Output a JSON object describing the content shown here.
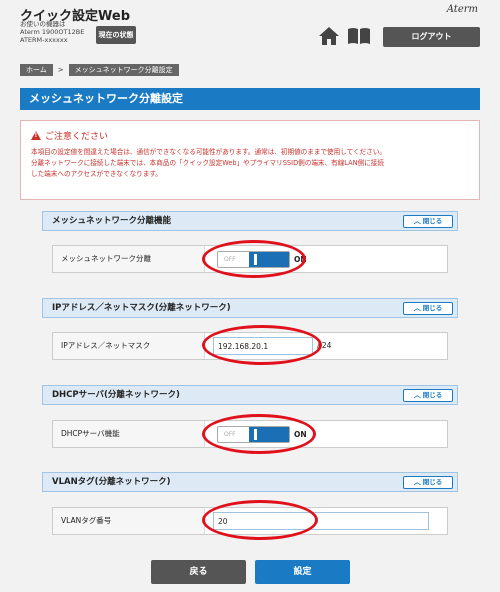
{
  "header": {
    "app_title": "クイック設定Web",
    "device_lines": [
      "お使いの機器は",
      "Aterm 1900OT12BE",
      "ATERM-xxxxxx"
    ],
    "status_button": "現在の状態",
    "brand": "Aterm",
    "logout_button": "ログアウト"
  },
  "breadcrumb": {
    "home": "ホーム",
    "separator": ">",
    "current": "メッシュネットワーク分離設定"
  },
  "page_title": "メッシュネットワーク分離設定",
  "notice": {
    "heading": "ご注意ください",
    "lines": [
      "本項目の設定値を間違えた場合は、通信ができなくなる可能性があります。通常は、初期値のままで使用してください。",
      "分離ネットワークに接続した端末では、本商品の「クイック設定Web」やプライマリSSID側の端末、有線LAN側に接続",
      "した端末へのアクセスができなくなります。"
    ]
  },
  "close_label": "閉じる",
  "sections": {
    "mesh": {
      "title": "メッシュネットワーク分離機能",
      "label": "メッシュネットワーク分離",
      "toggle_off": "OFF",
      "toggle_on": "ON"
    },
    "ip": {
      "title": "IPアドレス／ネットマスク(分離ネットワーク)",
      "label": "IPアドレス／ネットマスク",
      "ip_value": "192.168.20.1",
      "mask_value": "/ 24"
    },
    "dhcp": {
      "title": "DHCPサーバ(分離ネットワーク)",
      "label": "DHCPサーバ機能",
      "toggle_off": "OFF",
      "toggle_on": "ON"
    },
    "vlan": {
      "title": "VLANタグ(分離ネットワーク)",
      "label": "VLANタグ番号",
      "vlan_value": "20"
    }
  },
  "buttons": {
    "back": "戻る",
    "set": "設定"
  },
  "colors": {
    "accent": "#1a7bc4",
    "warning": "#c9302c",
    "highlight": "#e0111b"
  }
}
